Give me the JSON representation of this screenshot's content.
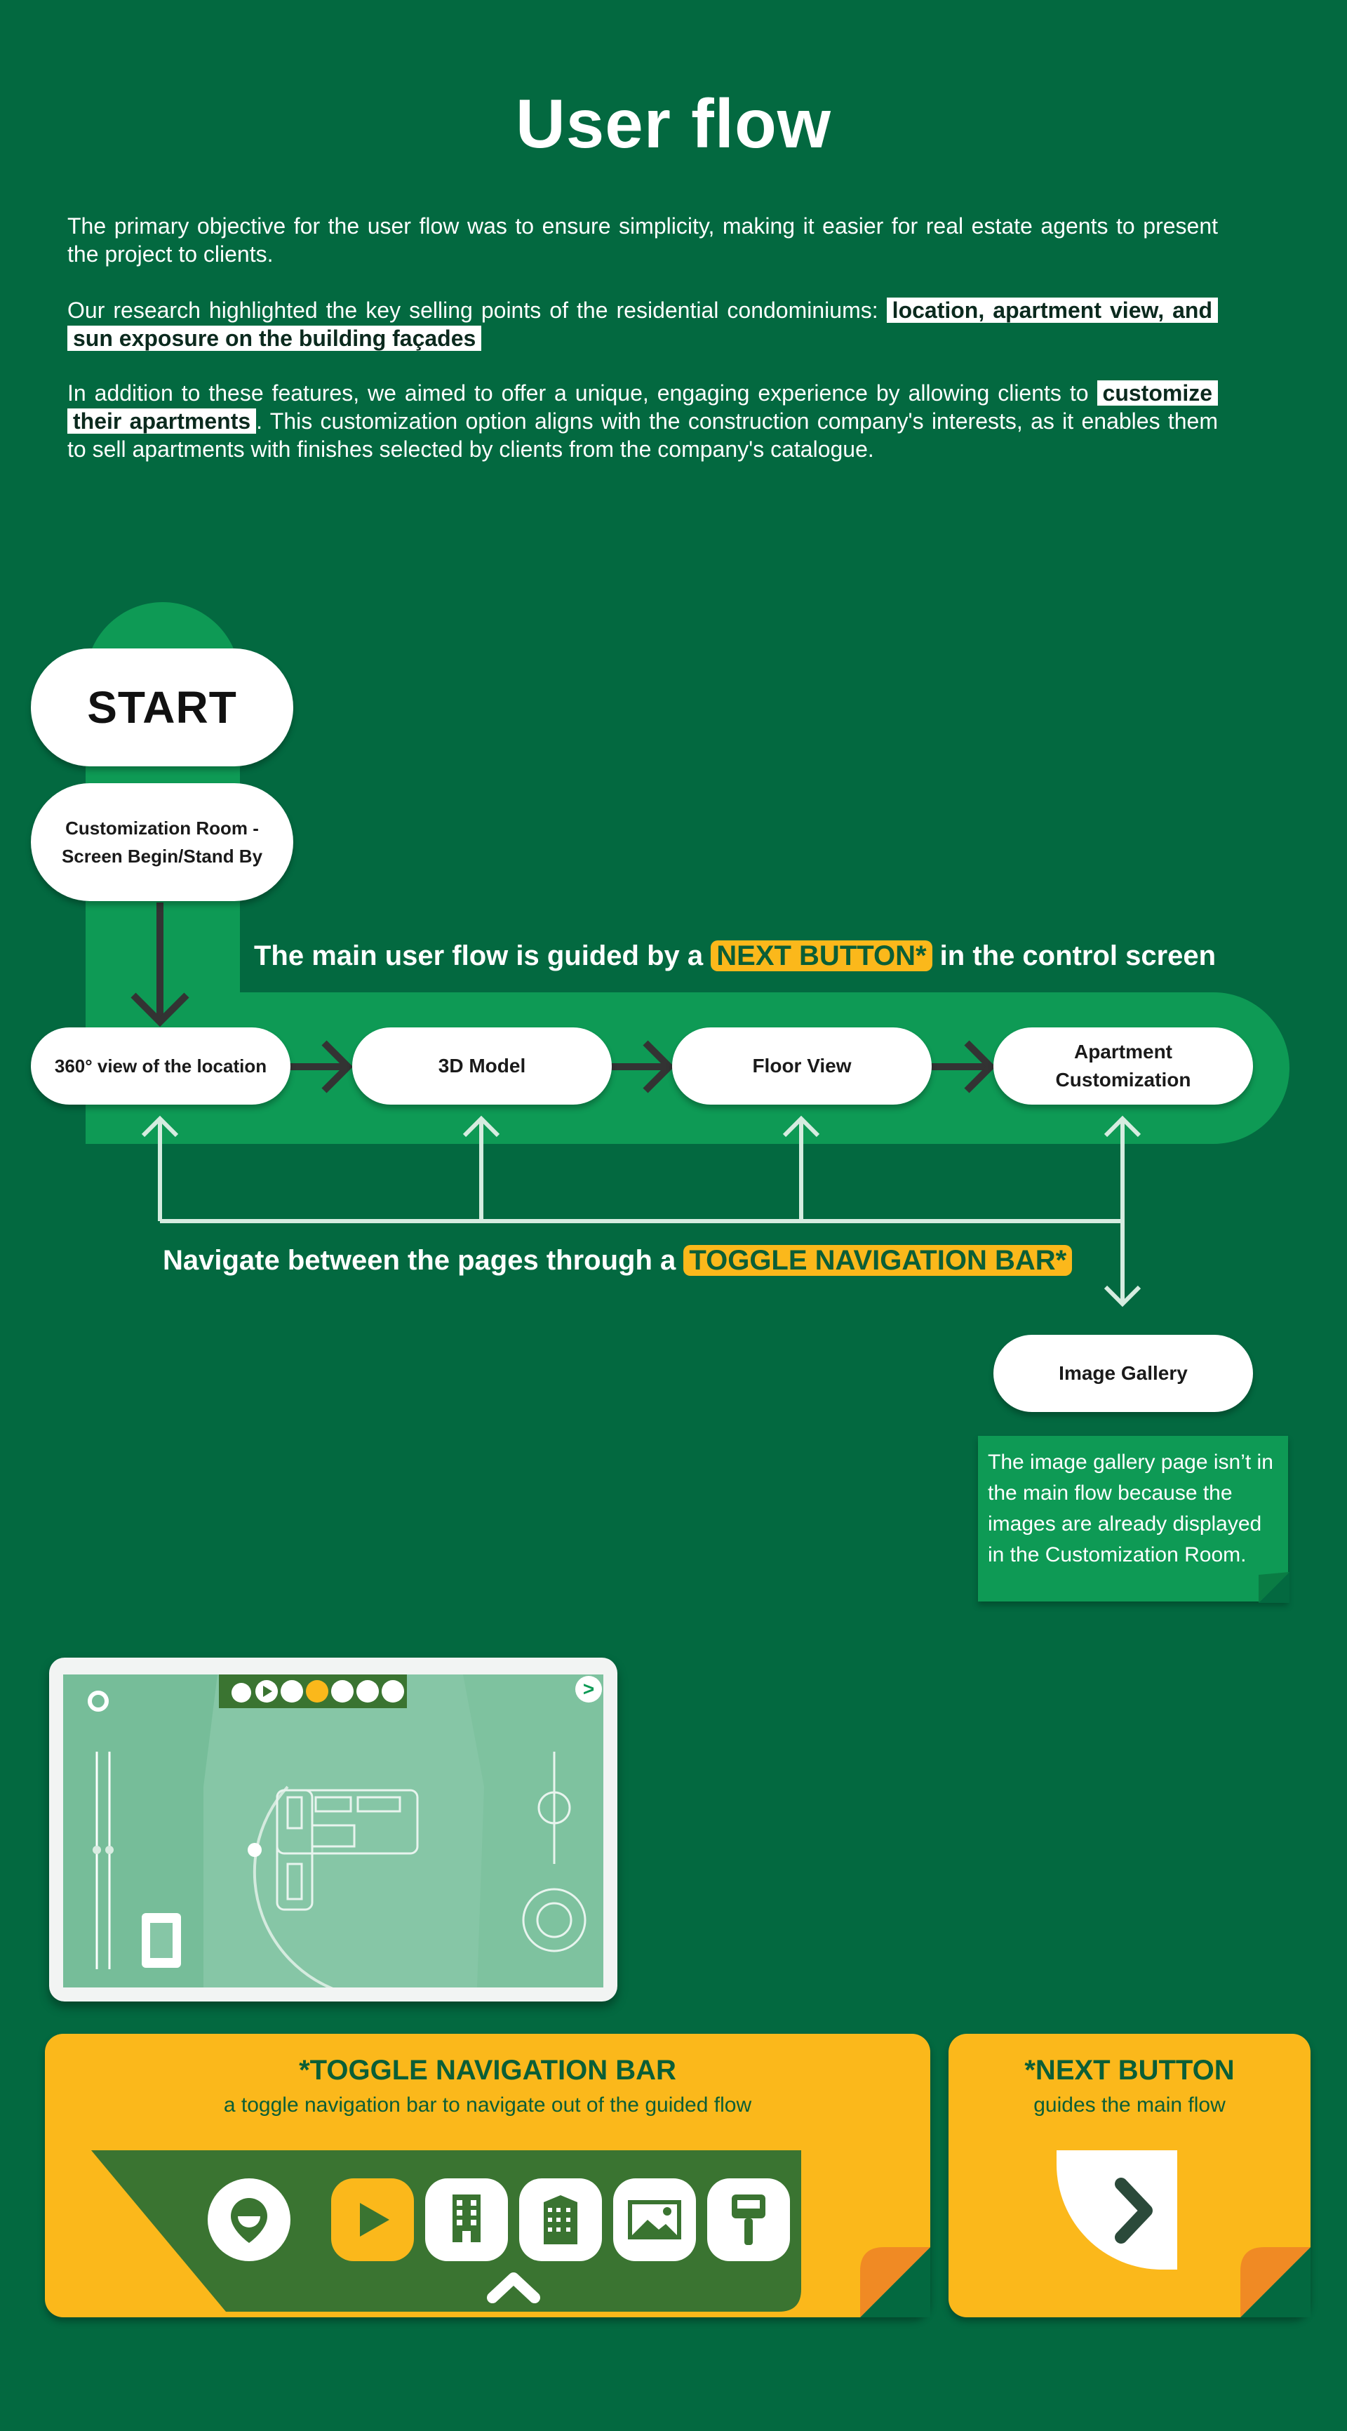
{
  "title": "User flow",
  "intro": {
    "p1": "The primary objective for the user flow was to ensure simplicity, making it easier for real estate agents to present the project to clients.",
    "p2_pre": "Our research highlighted the key selling points of the residential condominiums:",
    "p2_highlight": "location, apartment view, and sun exposure on the building façades",
    "p3_pre": "In addition to these features, we aimed to offer a unique, engaging experience by allowing clients to",
    "p3_highlight": "customize their apartments",
    "p3_post": ". This customization option aligns with the construction company's interests, as it enables them to sell apartments with finishes selected by clients from the company's catalogue."
  },
  "flow": {
    "start": "START",
    "stand_by": "Customization Room - Screen Begin/Stand By",
    "guided_pre": "The main user flow is guided by a",
    "guided_label": "NEXT BUTTON*",
    "guided_post": "in the control screen",
    "steps": [
      "360° view of the location",
      "3D Model",
      "Floor View",
      "Apartment Customization"
    ],
    "nav_pre": "Navigate between the pages through a",
    "nav_label": "TOGGLE NAVIGATION BAR*",
    "gallery": "Image Gallery",
    "gallery_note": "The image gallery page isn’t in the main flow because the images are already displayed in the Customization Room."
  },
  "screen": {
    "next_glyph": ">",
    "toolbar_icons": [
      "rotate-icon",
      "play-icon",
      "building-icon",
      "building-3d-icon",
      "pin-icon",
      "image-icon",
      "paint-roller-icon"
    ]
  },
  "cards": {
    "toggle": {
      "heading": "*TOGGLE NAVIGATION BAR",
      "sub": "a toggle navigation bar to navigate out of the guided flow",
      "icons": [
        "location-pin-icon",
        "play-icon",
        "building-icon",
        "building-3d-icon",
        "landscape-image-icon",
        "paint-roller-icon"
      ]
    },
    "next": {
      "heading": "*NEXT BUTTON",
      "sub": "guides the main flow"
    }
  },
  "colors": {
    "background": "#036940",
    "flow_band": "#0e9a55",
    "accent_yellow": "#fbb81b",
    "accent_orange": "#f08a24",
    "dark_green": "#3a7431",
    "arrow_dark": "#333333",
    "arrow_light": "#d6ece0"
  }
}
